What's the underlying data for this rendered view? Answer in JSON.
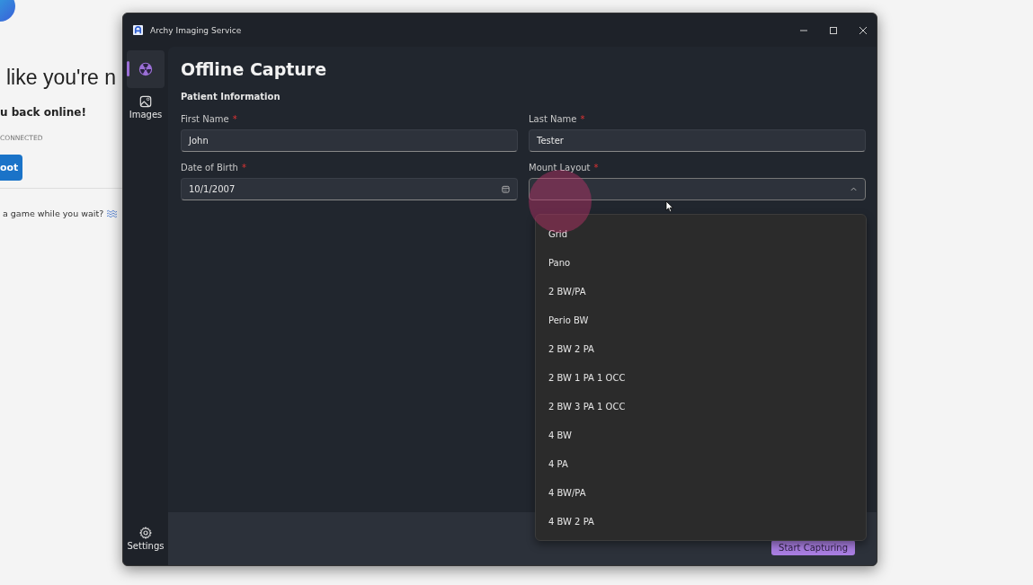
{
  "background_page": {
    "heading": "like you're n",
    "subheading": "u back online!",
    "status": "CONNECTED",
    "button": "oot",
    "game_prompt": "a game while you wait?"
  },
  "window": {
    "title": "Archy Imaging Service"
  },
  "sidebar": {
    "items": [
      {
        "kind": "capture",
        "selected": true
      },
      {
        "kind": "images",
        "label": "Images",
        "selected": false
      }
    ],
    "settings": {
      "label": "Settings"
    }
  },
  "page": {
    "title": "Offline Capture",
    "section": "Patient Information",
    "fields": [
      {
        "kind": "text",
        "label": "First Name",
        "required_mark": "*",
        "value": "John"
      },
      {
        "kind": "text",
        "label": "Last Name",
        "required_mark": "*",
        "value": "Tester"
      },
      {
        "kind": "date",
        "label": "Date of Birth",
        "required_mark": "*",
        "value": "10/1/2007"
      },
      {
        "kind": "select",
        "label": "Mount Layout",
        "required_mark": "*",
        "expanded": true,
        "options": [
          "Grid",
          "Pano",
          "2 BW/PA",
          "Perio BW",
          "2 BW 2 PA",
          "2 BW 1 PA 1 OCC",
          "2 BW 3 PA 1 OCC",
          "4 BW",
          "4 PA",
          "4 BW/PA",
          "4 BW 2 PA"
        ]
      }
    ]
  },
  "footer": {
    "button": "Start Capturing"
  }
}
